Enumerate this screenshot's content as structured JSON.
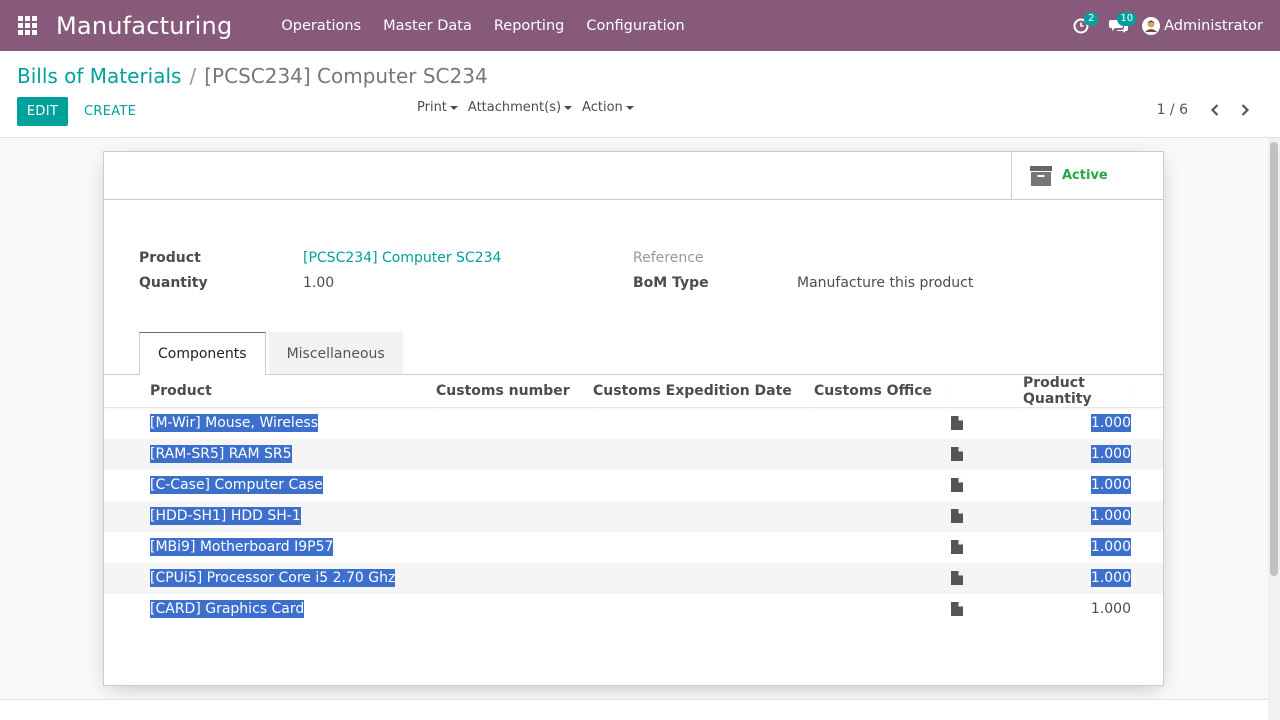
{
  "navbar": {
    "app_name": "Manufacturing",
    "menu": [
      "Operations",
      "Master Data",
      "Reporting",
      "Configuration"
    ],
    "activity_count": "2",
    "messages_count": "10",
    "user_name": "Administrator",
    "colors": {
      "brand": "#875a7b",
      "accent": "#00a09d"
    }
  },
  "control_panel": {
    "breadcrumb_parent": "Bills of Materials",
    "breadcrumb_separator": "/",
    "breadcrumb_current": "[PCSC234] Computer SC234",
    "edit_label": "EDIT",
    "create_label": "CREATE",
    "print_label": "Print",
    "attachments_label": "Attachment(s)",
    "action_label": "Action",
    "pager_value": "1 / 6"
  },
  "form": {
    "active_label": "Active",
    "product_label": "Product",
    "product_value": "[PCSC234] Computer SC234",
    "quantity_label": "Quantity",
    "quantity_value": "1.00",
    "reference_label": "Reference",
    "reference_value": "",
    "bom_type_label": "BoM Type",
    "bom_type_value": "Manufacture this product",
    "tabs": [
      "Components",
      "Miscellaneous"
    ],
    "active_tab": "Components"
  },
  "components_table": {
    "columns": [
      "Product",
      "Customs number",
      "Customs Expedition Date",
      "Customs Office",
      "Product Quantity"
    ],
    "rows": [
      {
        "product": "[M-Wir] Mouse, Wireless",
        "quantity": "1.000",
        "selected": true
      },
      {
        "product": "[RAM-SR5] RAM SR5",
        "quantity": "1.000",
        "selected": true
      },
      {
        "product": "[C-Case] Computer Case",
        "quantity": "1.000",
        "selected": true
      },
      {
        "product": "[HDD-SH1] HDD SH-1",
        "quantity": "1.000",
        "selected": true
      },
      {
        "product": "[MBi9] Motherboard I9P57",
        "quantity": "1.000",
        "selected": true
      },
      {
        "product": "[CPUi5] Processor Core i5 2.70 Ghz",
        "quantity": "1.000",
        "selected": true
      },
      {
        "product": "[CARD] Graphics Card",
        "quantity": "1.000",
        "selected": false
      }
    ],
    "row_icon": "document-icon"
  }
}
